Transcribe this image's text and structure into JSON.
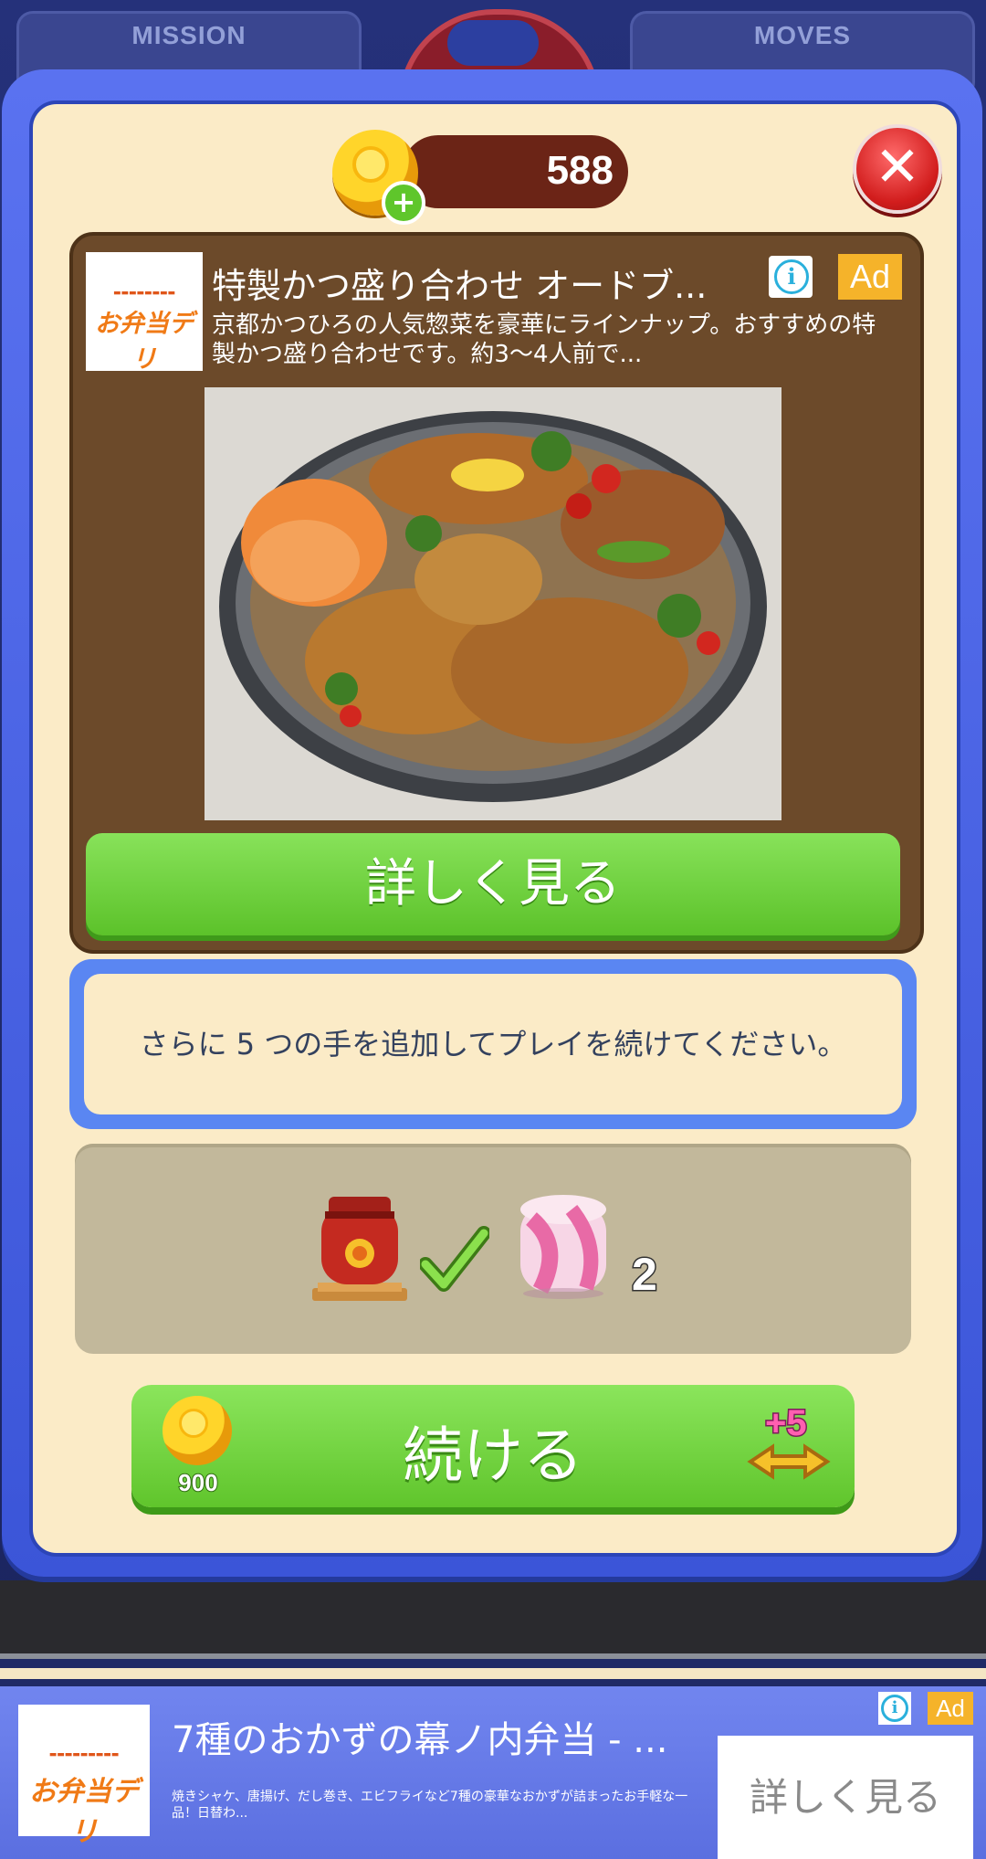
{
  "hud": {
    "mission_label": "MISSION",
    "moves_label": "MOVES"
  },
  "header": {
    "coins": "588"
  },
  "close_icon": "close-icon",
  "ad": {
    "logo_text": "お弁当デリ",
    "title": "特製かつ盛り合わせ オードブ...",
    "description": "京都かつひろの人気惣菜を豪華にラインナップ。おすすめの特製かつ盛り合わせです。約3〜4人前で...",
    "badge": "Ad",
    "cta_label": "詳しく見る"
  },
  "message": {
    "text": "さらに 5 つの手を追加してプレイを続けてください。"
  },
  "boosters": [
    {
      "name": "lantern",
      "state": "done"
    },
    {
      "name": "candy",
      "count": "2"
    }
  ],
  "continue_button": {
    "label": "続ける",
    "cost": "900",
    "moves_bonus": "+5"
  },
  "banner": {
    "logo_text": "お弁当デリ",
    "title": "7種のおかずの幕ノ内弁当 - ...",
    "description": "焼きシャケ、唐揚げ、だし巻き、エビフライなど7種の豪華なおかずが詰まったお手軽な一品！日替わ...",
    "badge": "Ad",
    "cta_label": "詳しく見る"
  },
  "colors": {
    "dialog_blue": "#4a64e6",
    "panel_cream": "#fbebc7",
    "button_green": "#6cd03a",
    "ad_brown": "#6c4a2a",
    "close_red": "#d21d1d"
  }
}
